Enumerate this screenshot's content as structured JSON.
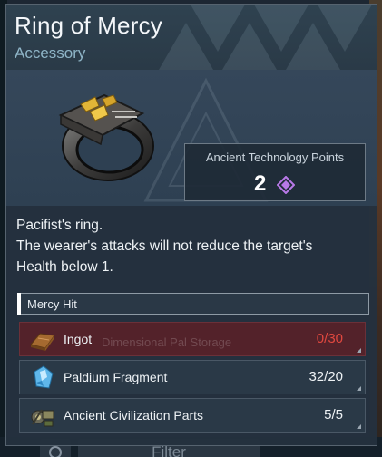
{
  "item": {
    "name": "Ring of Mercy",
    "category": "Accessory",
    "icon": "ring-icon"
  },
  "tech_points": {
    "label": "Ancient Technology Points",
    "value": "2",
    "icon": "ancient-tech-point-icon",
    "icon_color": "#b879e8"
  },
  "description": [
    "Pacifist's ring.",
    "The wearer's attacks will not reduce the target's",
    "Health below 1."
  ],
  "passive_skill": "Mercy Hit",
  "materials_colors": {
    "lacking_row": "#53222a",
    "lacking_text": "#e0483f"
  },
  "materials": [
    {
      "name": "Ingot",
      "have": "0",
      "sep": "/",
      "need": "30",
      "icon": "ingot-icon",
      "lacking": true
    },
    {
      "name": "Paldium Fragment",
      "have": "32",
      "sep": "/",
      "need": "20",
      "icon": "paldium-fragment-icon",
      "lacking": false
    },
    {
      "name": "Ancient Civilization Parts",
      "have": "5",
      "sep": "/",
      "need": "5",
      "icon": "ancient-civilization-parts-icon",
      "lacking": false
    }
  ],
  "background": {
    "filter_label": "Filter",
    "ghost_label": "Dimensional Pal Storage"
  }
}
